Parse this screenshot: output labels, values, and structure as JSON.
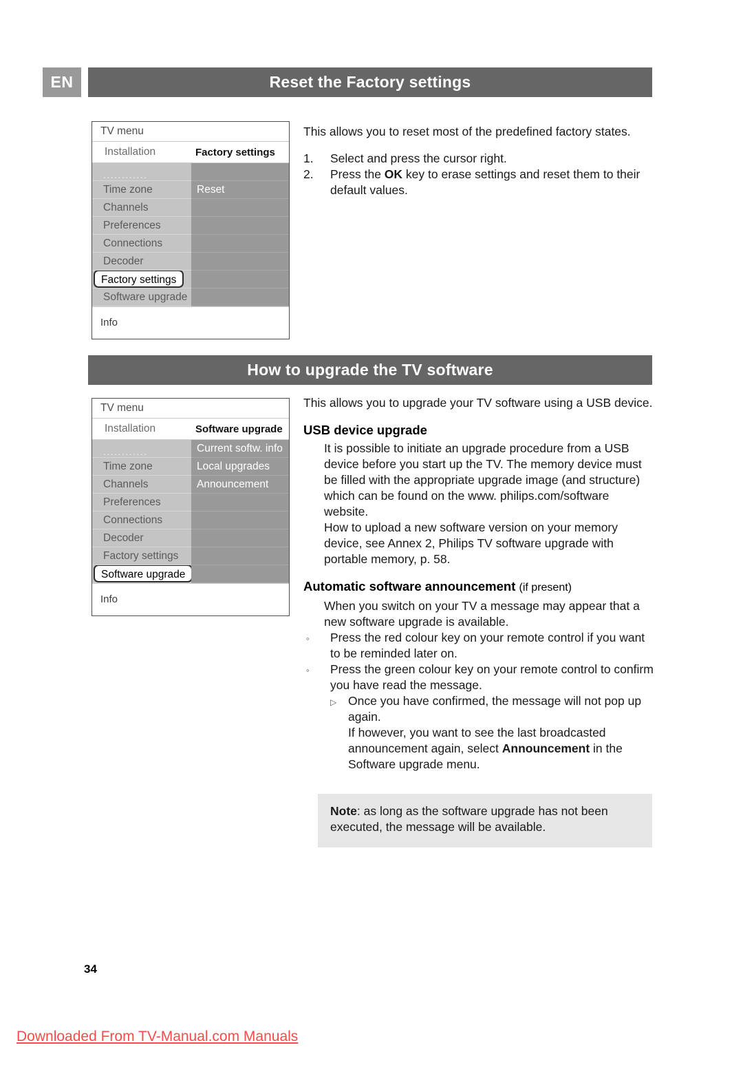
{
  "language_badge": "EN",
  "sections": [
    {
      "banner_title": "Reset the Factory settings",
      "menu": {
        "title": "TV menu",
        "subhead_left": "Installation",
        "subhead_right": "Factory settings",
        "left_items": [
          "............",
          "Time zone",
          "Channels",
          "Preferences",
          "Connections",
          "Decoder",
          "Factory settings",
          "Software upgrade"
        ],
        "selected_left_item": "Factory settings",
        "right_items": [
          "",
          "Reset",
          "",
          "",
          "",
          "",
          "",
          ""
        ],
        "info_label": "Info"
      },
      "intro": "This allows you to reset most of the predefined factory states.",
      "steps": [
        {
          "num": "1.",
          "text": "Select and press the cursor right."
        },
        {
          "num": "2.",
          "text_before": "Press the ",
          "bold": "OK",
          "text_after": " key to erase settings and reset them to their default values."
        }
      ]
    },
    {
      "banner_title": "How to upgrade the TV software",
      "menu": {
        "title": "TV menu",
        "subhead_left": "Installation",
        "subhead_right": "Software upgrade",
        "left_items": [
          "............",
          "Time zone",
          "Channels",
          "Preferences",
          "Connections",
          "Decoder",
          "Factory settings",
          "Software upgrade"
        ],
        "selected_left_item": "Software upgrade",
        "right_items": [
          "Current softw. info",
          "Local upgrades",
          "Announcement",
          "",
          "",
          "",
          "",
          ""
        ],
        "info_label": "Info"
      },
      "intro": "This allows you to upgrade your TV software using a USB device.",
      "subhead_usb": "USB device upgrade",
      "usb_paragraph": "It is possible to initiate an upgrade procedure from a USB device before you start up the TV. The memory device must be filled with the appropriate upgrade image (and structure) which can be found on the www. philips.com/software website.",
      "usb_paragraph2": "How to upload a new software version on your memory device, see Annex 2, Philips TV software upgrade with portable memory, p. 58.",
      "subhead_auto": "Automatic software announcement",
      "subhead_auto_light": "(if present)",
      "auto_paragraph": "When you switch on your TV a message may appear that a new software upgrade is available.",
      "bullets": [
        {
          "marker": "◦",
          "text": "Press the red colour key on your remote control if you want to be reminded later on."
        },
        {
          "marker": "◦",
          "text": "Press the green colour key on your remote control to confirm you have read the message."
        }
      ],
      "sub_bullets": [
        {
          "marker": "▷",
          "text": "Once you have confirmed, the message will not pop up again."
        }
      ],
      "sub_paragraph_before": "If however, you want to see the last broadcasted announcement again, select ",
      "sub_paragraph_bold": "Announcement",
      "sub_paragraph_after": " in the Software upgrade menu.",
      "note": {
        "label": "Note",
        "text": ": as long as the software upgrade has not been executed, the message will be available."
      }
    }
  ],
  "page_number": "34",
  "footer": "Downloaded From TV-Manual.com Manuals",
  "colors": {
    "banner": "#666666",
    "badge": "#999999",
    "menu_left_col": "#c4c4c4",
    "menu_right_col": "#999999",
    "note_bg": "#e6e6e6",
    "footer_red": "#fb4a4a"
  }
}
